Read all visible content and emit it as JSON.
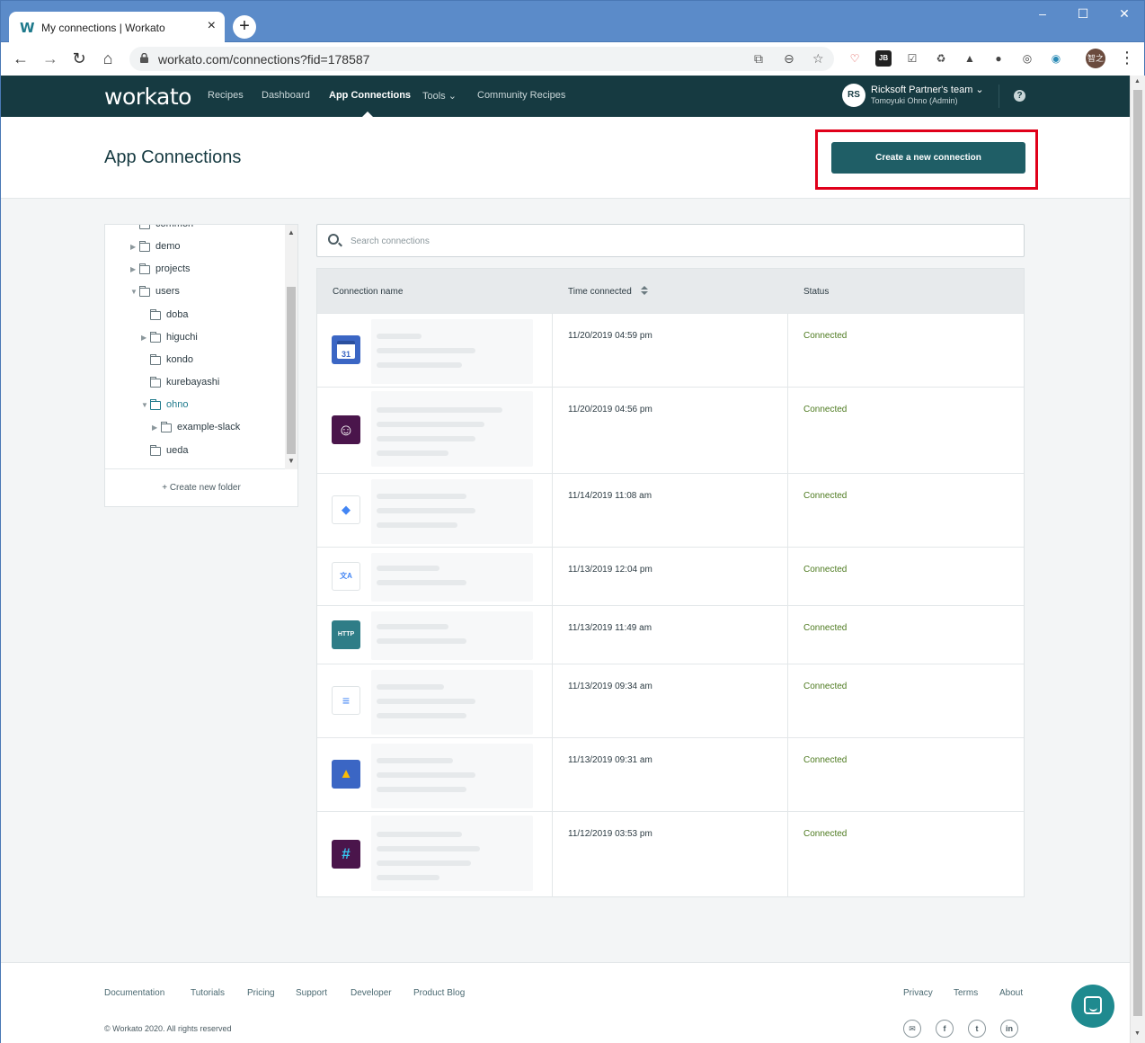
{
  "browser": {
    "tab_title": "My connections | Workato",
    "tab_favicon": "W",
    "new_tab": "+",
    "close_tab": "×",
    "url": "workato.com/connections?fid=178587",
    "profile_initials": "智之",
    "window_controls": [
      "–",
      "☐",
      "✕"
    ]
  },
  "nav": {
    "logo": "workato",
    "links": [
      "Recipes",
      "Dashboard",
      "App Connections",
      "Tools",
      "Community Recipes"
    ],
    "active": "App Connections",
    "team_avatar": "RS",
    "team_name": "Ricksoft Partner's team",
    "team_user": "Tomoyuki Ohno (Admin)",
    "help": "?"
  },
  "page": {
    "title": "App Connections",
    "create_button": "Create a new connection"
  },
  "folders": {
    "items": [
      {
        "label": "common",
        "depth": 0,
        "arrow": ""
      },
      {
        "label": "demo",
        "depth": 0,
        "arrow": "▶"
      },
      {
        "label": "projects",
        "depth": 0,
        "arrow": "▶"
      },
      {
        "label": "users",
        "depth": 0,
        "arrow": "▼"
      },
      {
        "label": "doba",
        "depth": 1,
        "arrow": ""
      },
      {
        "label": "higuchi",
        "depth": 1,
        "arrow": "▶"
      },
      {
        "label": "kondo",
        "depth": 1,
        "arrow": ""
      },
      {
        "label": "kurebayashi",
        "depth": 1,
        "arrow": ""
      },
      {
        "label": "ohno",
        "depth": 1,
        "arrow": "▼"
      },
      {
        "label": "example-slack",
        "depth": 2,
        "arrow": "▶"
      },
      {
        "label": "ueda",
        "depth": 1,
        "arrow": ""
      }
    ],
    "create_folder": "+ Create new folder"
  },
  "search": {
    "placeholder": "Search connections",
    "value": ""
  },
  "table": {
    "headers": [
      "Connection name",
      "Time connected",
      "Status"
    ],
    "rows": [
      {
        "icon": "google-calendar-icon",
        "icon_text": "31",
        "icon_bg": "#3b66c4",
        "time": "11/20/2019 04:59 pm",
        "status": "Connected"
      },
      {
        "icon": "slack-bot-icon",
        "icon_text": "☺",
        "icon_bg": "#4a154b",
        "time": "11/20/2019 04:56 pm",
        "status": "Connected"
      },
      {
        "icon": "google-cloud-icon",
        "icon_text": "◆",
        "icon_bg": "#ffffff",
        "time": "11/14/2019 11:08 am",
        "status": "Connected"
      },
      {
        "icon": "google-translate-icon",
        "icon_text": "文A",
        "icon_bg": "#ffffff",
        "time": "11/13/2019 12:04 pm",
        "status": "Connected"
      },
      {
        "icon": "http-icon",
        "icon_text": "HTTP",
        "icon_bg": "#2f7d87",
        "time": "11/13/2019 11:49 am",
        "status": "Connected"
      },
      {
        "icon": "google-nl-icon",
        "icon_text": "≡",
        "icon_bg": "#ffffff",
        "time": "11/13/2019 09:34 am",
        "status": "Connected"
      },
      {
        "icon": "google-drive-icon",
        "icon_text": "▲",
        "icon_bg": "#3b66c4",
        "time": "11/13/2019 09:31 am",
        "status": "Connected"
      },
      {
        "icon": "slack-icon",
        "icon_text": "#",
        "icon_bg": "#4a154b",
        "time": "11/12/2019 03:53 pm",
        "status": "Connected"
      }
    ]
  },
  "footer": {
    "links_left": [
      "Documentation",
      "Tutorials",
      "Pricing",
      "Support",
      "Developer",
      "Product Blog"
    ],
    "links_right": [
      "Privacy",
      "Terms",
      "About"
    ],
    "copyright": "© Workato 2020. All rights reserved",
    "social": [
      "✉",
      "f",
      "t",
      "in"
    ]
  },
  "colors": {
    "nav_bg": "#163a41",
    "button_bg": "#1f5e66",
    "status_green": "#4d7a1f",
    "highlight_red": "#e0001a"
  }
}
